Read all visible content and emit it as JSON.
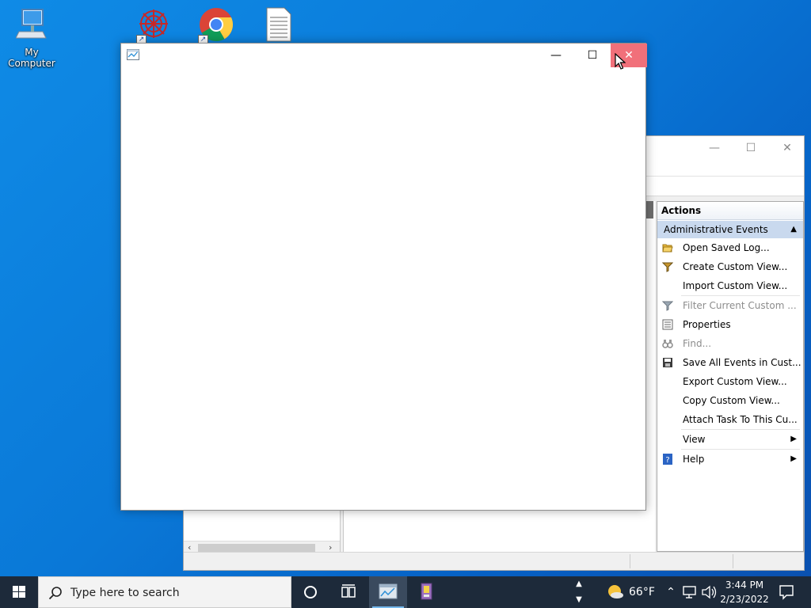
{
  "desktop": {
    "icons": [
      {
        "label": "My Computer",
        "icon": "computer-icon"
      },
      {
        "label": "",
        "icon": "red-app-shortcut-icon"
      },
      {
        "label": "",
        "icon": "chrome-shortcut-icon"
      },
      {
        "label": "",
        "icon": "text-document-icon"
      }
    ]
  },
  "event_viewer": {
    "actions_header": "Actions",
    "section": "Administrative Events",
    "items": [
      {
        "label": "Open Saved Log...",
        "icon": "folder-open-icon",
        "enabled": true
      },
      {
        "label": "Create Custom View...",
        "icon": "filter-icon",
        "enabled": true
      },
      {
        "label": "Import Custom View...",
        "icon": "",
        "enabled": true
      },
      {
        "label": "Filter Current Custom ...",
        "icon": "filter-icon",
        "enabled": false
      },
      {
        "label": "Properties",
        "icon": "properties-icon",
        "enabled": true
      },
      {
        "label": "Find...",
        "icon": "binoculars-icon",
        "enabled": false
      },
      {
        "label": "Save All Events in Cust...",
        "icon": "save-icon",
        "enabled": true
      },
      {
        "label": "Export Custom View...",
        "icon": "",
        "enabled": true
      },
      {
        "label": "Copy Custom View...",
        "icon": "",
        "enabled": true
      },
      {
        "label": "Attach Task To This Cu...",
        "icon": "",
        "enabled": true
      },
      {
        "label": "View",
        "icon": "",
        "enabled": true,
        "submenu": true
      },
      {
        "label": "Help",
        "icon": "help-icon",
        "enabled": true,
        "submenu": true
      }
    ]
  },
  "taskbar": {
    "search_placeholder": "Type here to search",
    "weather_temp": "66°F",
    "time": "3:44 PM",
    "date": "2/23/2022"
  },
  "colors": {
    "close_hover": "#f1707a",
    "section_bg": "#c9d9ee",
    "taskbar_bg": "#1d2a3a"
  }
}
